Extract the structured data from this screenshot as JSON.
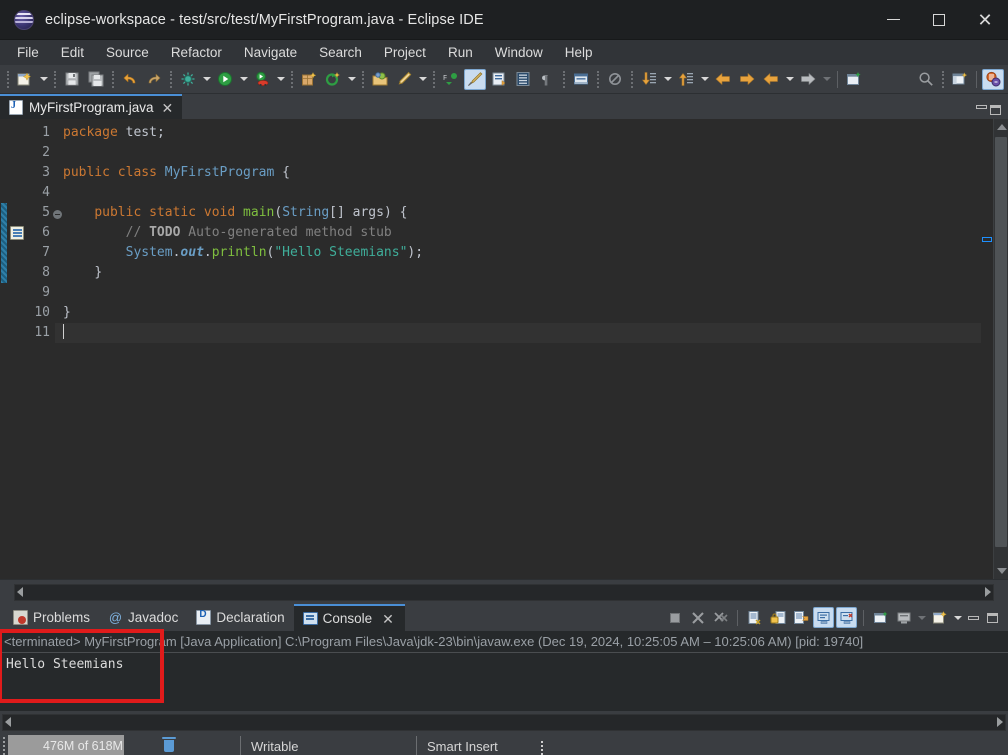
{
  "window": {
    "title": "eclipse-workspace - test/src/test/MyFirstProgram.java - Eclipse IDE",
    "logo_icon": "eclipse-logo-icon",
    "minimize_label": "Minimize",
    "maximize_label": "Maximize",
    "close_label": "Close",
    "close_glyph": "✕"
  },
  "menubar": {
    "items": [
      {
        "label": "File"
      },
      {
        "label": "Edit"
      },
      {
        "label": "Source"
      },
      {
        "label": "Refactor"
      },
      {
        "label": "Navigate"
      },
      {
        "label": "Search"
      },
      {
        "label": "Project"
      },
      {
        "label": "Run"
      },
      {
        "label": "Window"
      },
      {
        "label": "Help"
      }
    ]
  },
  "toolbar": {
    "items": [
      {
        "icon": "new-wizard-icon",
        "dropdown": true
      },
      {
        "sep": true
      },
      {
        "icon": "save-icon"
      },
      {
        "icon": "save-all-icon"
      },
      {
        "sep": true
      },
      {
        "icon": "undo-icon"
      },
      {
        "icon": "redo-icon"
      },
      {
        "sep": true
      },
      {
        "icon": "debug-icon",
        "dropdown": true
      },
      {
        "icon": "run-icon",
        "dropdown": true
      },
      {
        "icon": "coverage-icon",
        "dropdown": true
      },
      {
        "sep": true
      },
      {
        "icon": "new-java-project-icon"
      },
      {
        "icon": "new-class-icon",
        "dropdown": true
      },
      {
        "sep": true
      },
      {
        "icon": "open-type-icon"
      },
      {
        "icon": "new-annotation-icon",
        "dropdown": true
      },
      {
        "sep": true
      },
      {
        "icon": "toggle-java-elements-icon"
      },
      {
        "icon": "toggle-mark-occurrences-icon",
        "selected": true
      },
      {
        "icon": "show-whitespace-icon"
      },
      {
        "icon": "block-selection-icon"
      },
      {
        "icon": "show-formatting-icon"
      },
      {
        "sep": true
      },
      {
        "icon": "open-task-icon"
      },
      {
        "sep": true
      },
      {
        "icon": "skip-all-breakpoints-icon"
      },
      {
        "sep": true
      },
      {
        "icon": "next-annotation-icon",
        "dropdown": true
      },
      {
        "icon": "previous-annotation-icon",
        "dropdown": true
      },
      {
        "icon": "back-arrow-icon"
      },
      {
        "icon": "forward-arrow-icon"
      },
      {
        "sep": true
      },
      {
        "icon": "previous-edit-icon",
        "dropdown": true
      },
      {
        "icon": "next-edit-icon",
        "dropdown": true,
        "dim": true
      },
      {
        "sepsolid": true
      },
      {
        "icon": "new-window-icon"
      }
    ],
    "right_items": [
      {
        "icon": "search-icon"
      },
      {
        "sep": true
      },
      {
        "icon": "open-perspective-icon"
      },
      {
        "sepsolid": true
      },
      {
        "icon": "java-perspective-icon",
        "selected": true
      }
    ]
  },
  "editor": {
    "tab": {
      "file_icon": "java-file-icon",
      "filename": "MyFirstProgram.java",
      "close_glyph": "✕"
    },
    "view_minimize_label": "Minimize",
    "view_maximize_label": "Maximize",
    "line_numbers": [
      "1",
      "2",
      "3",
      "4",
      "5",
      "6",
      "7",
      "8",
      "9",
      "10",
      "11"
    ],
    "fold_marker_line": 5,
    "todo_marker_line": 6,
    "changed_lines": [
      5,
      6,
      7,
      8
    ],
    "current_line": 11,
    "lines": [
      {
        "n": 1,
        "tokens": [
          {
            "t": "package",
            "c": "kw"
          },
          {
            "t": " ",
            "c": "plain"
          },
          {
            "t": "test",
            "c": "plain"
          },
          {
            "t": ";",
            "c": "plain"
          }
        ]
      },
      {
        "n": 2,
        "tokens": []
      },
      {
        "n": 3,
        "tokens": [
          {
            "t": "public",
            "c": "kw"
          },
          {
            "t": " ",
            "c": "plain"
          },
          {
            "t": "class",
            "c": "kw"
          },
          {
            "t": " ",
            "c": "plain"
          },
          {
            "t": "MyFirstProgram",
            "c": "cls"
          },
          {
            "t": " ",
            "c": "plain"
          },
          {
            "t": "{",
            "c": "plain"
          }
        ]
      },
      {
        "n": 4,
        "tokens": []
      },
      {
        "n": 5,
        "tokens": [
          {
            "t": "    ",
            "c": "plain"
          },
          {
            "t": "public",
            "c": "kw"
          },
          {
            "t": " ",
            "c": "plain"
          },
          {
            "t": "static",
            "c": "kw"
          },
          {
            "t": " ",
            "c": "plain"
          },
          {
            "t": "void",
            "c": "kw"
          },
          {
            "t": " ",
            "c": "plain"
          },
          {
            "t": "main",
            "c": "meth"
          },
          {
            "t": "(",
            "c": "plain"
          },
          {
            "t": "String",
            "c": "type"
          },
          {
            "t": "[] ",
            "c": "plain"
          },
          {
            "t": "args",
            "c": "plain"
          },
          {
            "t": ") {",
            "c": "plain"
          }
        ]
      },
      {
        "n": 6,
        "tokens": [
          {
            "t": "        ",
            "c": "plain"
          },
          {
            "t": "// ",
            "c": "cmt"
          },
          {
            "t": "TODO",
            "c": "todo"
          },
          {
            "t": " Auto-generated method stub",
            "c": "cmt"
          }
        ]
      },
      {
        "n": 7,
        "tokens": [
          {
            "t": "        ",
            "c": "plain"
          },
          {
            "t": "System",
            "c": "type"
          },
          {
            "t": ".",
            "c": "plain"
          },
          {
            "t": "out",
            "c": "fld"
          },
          {
            "t": ".",
            "c": "plain"
          },
          {
            "t": "println",
            "c": "meth"
          },
          {
            "t": "(",
            "c": "plain"
          },
          {
            "t": "\"Hello Steemians\"",
            "c": "str"
          },
          {
            "t": ");",
            "c": "plain"
          }
        ]
      },
      {
        "n": 8,
        "tokens": [
          {
            "t": "    ",
            "c": "plain"
          },
          {
            "t": "}",
            "c": "plain"
          }
        ]
      },
      {
        "n": 9,
        "tokens": []
      },
      {
        "n": 10,
        "tokens": [
          {
            "t": "}",
            "c": "plain"
          }
        ]
      },
      {
        "n": 11,
        "tokens": []
      }
    ],
    "overview_marker": "occurrence-marker"
  },
  "console_panel": {
    "tabs": [
      {
        "label": "Problems",
        "icon": "problems-icon",
        "active": false,
        "closable": false
      },
      {
        "label": "Javadoc",
        "icon": "javadoc-icon",
        "active": false,
        "closable": false
      },
      {
        "label": "Declaration",
        "icon": "declaration-icon",
        "active": false,
        "closable": false
      },
      {
        "label": "Console",
        "icon": "console-icon",
        "active": true,
        "closable": true
      }
    ],
    "close_glyph": "✕",
    "toolbar": [
      {
        "icon": "terminate-icon"
      },
      {
        "icon": "remove-launch-icon"
      },
      {
        "icon": "remove-all-terminated-icon"
      },
      {
        "sep": true
      },
      {
        "icon": "clear-console-icon"
      },
      {
        "icon": "scroll-lock-icon"
      },
      {
        "icon": "word-wrap-icon"
      },
      {
        "icon": "show-console-on-output-icon",
        "selected": true
      },
      {
        "icon": "show-console-on-error-icon",
        "selected": true
      },
      {
        "sep": true
      },
      {
        "icon": "pin-console-icon"
      },
      {
        "icon": "display-selected-console-icon",
        "dropdown": true
      },
      {
        "icon": "open-console-icon",
        "dropdown": true
      }
    ],
    "view_minimize_label": "Minimize",
    "view_maximize_label": "Maximize",
    "header": "<terminated> MyFirstProgram [Java Application] C:\\Program Files\\Java\\jdk-23\\bin\\javaw.exe  (Dec 19, 2024, 10:25:05 AM – 10:25:06 AM) [pid: 19740]",
    "output": "Hello Steemians",
    "annotation": {
      "shape": "rectangle",
      "color": "#e01b1b"
    }
  },
  "statusbar": {
    "heap_text": "476M of 618M",
    "heap_used_fraction": 0.77,
    "trash_icon": "trash-icon",
    "writable": "Writable",
    "insert_mode": "Smart Insert"
  },
  "colors": {
    "accent_tab": "#4a8fd6",
    "annotation_red": "#e01b1b",
    "editor_bg": "#2b2b2b",
    "chrome_bg": "#3a3d41",
    "titlebar_bg": "#1e2022",
    "keyword": "#cc7832",
    "type": "#6a9ec5",
    "method": "#7fbf3f",
    "string": "#3fae9a",
    "comment": "#808080"
  }
}
